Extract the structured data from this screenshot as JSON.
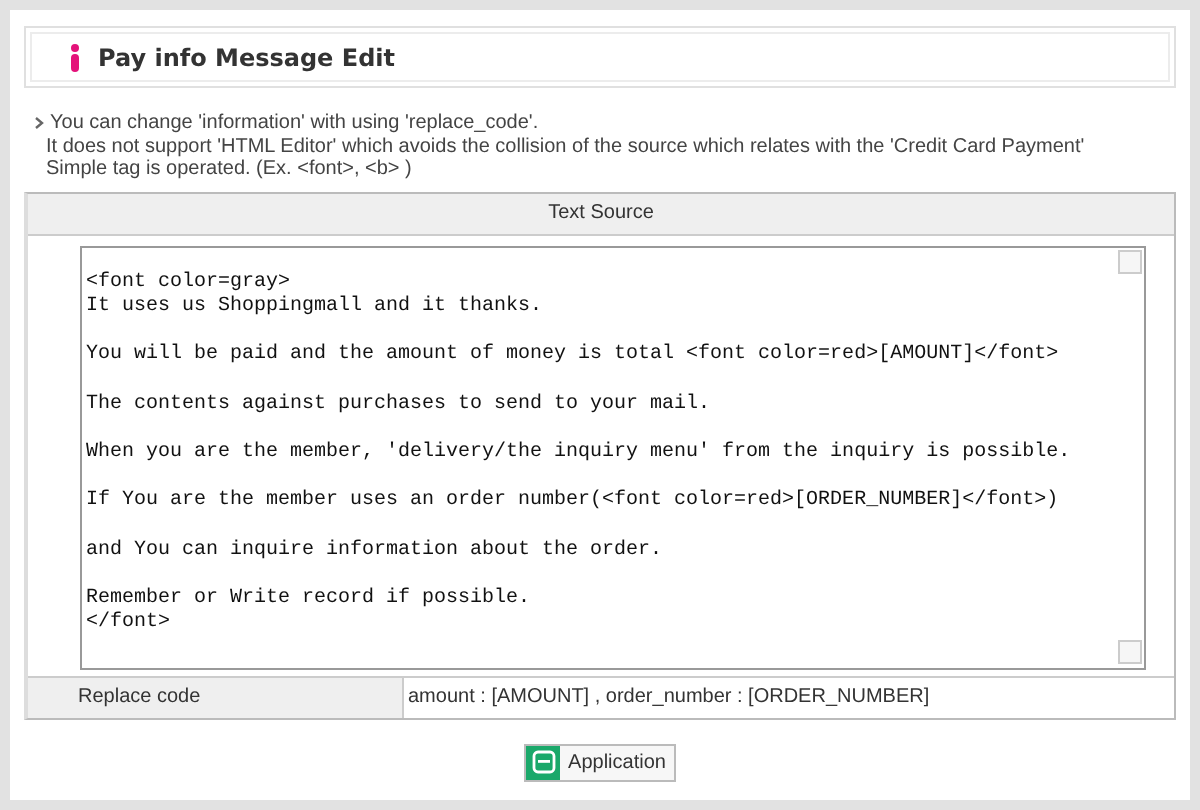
{
  "title": "Pay info Message Edit",
  "notes": [
    "You can change 'information' with using 'replace_code'.",
    "It does not support 'HTML Editor' which avoids the collision of the source which relates with the 'Credit Card Payment'",
    "Simple tag is operated. (Ex. <font>, <b> )"
  ],
  "table": {
    "header": "Text Source",
    "source": {
      "value": "<font color=gray>\nIt uses us Shoppingmall and it thanks.\n\nYou will be paid and the amount of money is total <font color=red>[AMOUNT]</font>\n\nThe contents against purchases to send to your mail.\n\nWhen you are the member, 'delivery/the inquiry menu' from the inquiry is possible.\n\nIf You are the member uses an order number(<font color=red>[ORDER_NUMBER]</font>)\n\nand You can inquire information about the order.\n\nRemember or Write record if possible.\n</font>"
    },
    "replace_label": "Replace code",
    "replace_value": "amount : [AMOUNT] , order_number : [ORDER_NUMBER]"
  },
  "button": {
    "label": "Application"
  }
}
